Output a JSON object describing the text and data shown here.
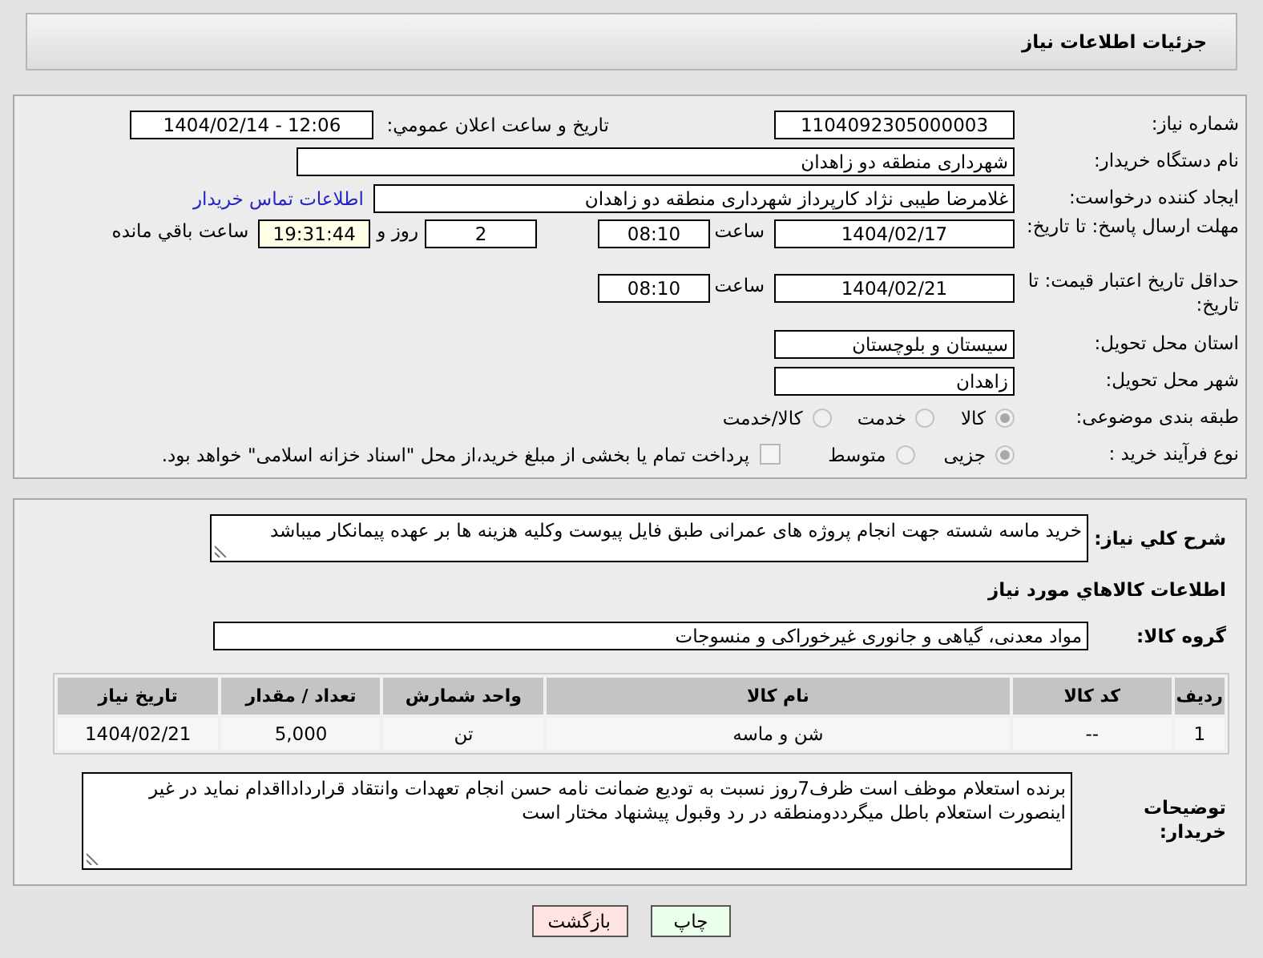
{
  "header": {
    "title": "جزئیات اطلاعات نیاز"
  },
  "need_number": {
    "label": "شماره نیاز:",
    "value": "1104092305000003"
  },
  "announce": {
    "label": "تاریخ و ساعت اعلان عمومي:",
    "value": "1404/02/14 - 12:06"
  },
  "buyer_org": {
    "label": "نام دستگاه خریدار:",
    "value": "شهرداری منطقه دو زاهدان"
  },
  "requester": {
    "label": "ایجاد کننده درخواست:",
    "value": "غلامرضا طیبی نژاد کارپرداز  شهرداری منطقه دو زاهدان",
    "link": "اطلاعات تماس خریدار"
  },
  "reply_deadline": {
    "label": "مهلت ارسال پاسخ: تا تاریخ:",
    "date": "1404/02/17",
    "time_label": "ساعت",
    "time": "08:10",
    "days": "2",
    "days_label": "روز و",
    "remaining": "19:31:44",
    "remaining_label": "ساعت باقي مانده"
  },
  "price_validity": {
    "label": "حداقل تاریخ اعتبار قیمت: تا تاریخ:",
    "date": "1404/02/21",
    "time_label": "ساعت",
    "time": "08:10"
  },
  "province": {
    "label": "استان محل تحویل:",
    "value": "سیستان و بلوچستان"
  },
  "city": {
    "label": "شهر محل تحویل:",
    "value": "زاهدان"
  },
  "category": {
    "label": "طبقه بندی موضوعی:",
    "options": [
      {
        "label": "کالا",
        "selected": true
      },
      {
        "label": "خدمت",
        "selected": false
      },
      {
        "label": "کالا/خدمت",
        "selected": false
      }
    ]
  },
  "purchase_type": {
    "label": "نوع فرآیند خرید :",
    "options": [
      {
        "label": "جزیی",
        "selected": true
      },
      {
        "label": "متوسط",
        "selected": false
      }
    ],
    "payment": {
      "label": "پرداخت تمام یا بخشی از مبلغ خرید،از محل \"اسناد خزانه اسلامی\" خواهد بود.",
      "checked": false
    }
  },
  "description": {
    "label": "شرح کلي نياز:",
    "value": "خرید ماسه شسته جهت انجام پروژه های عمرانی طبق فایل پیوست وکلیه هزینه ها بر عهده پیمانکار میباشد"
  },
  "goods_title": "اطلاعات کالاهاي مورد نياز",
  "goods_group": {
    "label": "گروه کالا:",
    "value": "مواد معدنی، گیاهی و جانوری غیرخوراکی و منسوجات"
  },
  "table": {
    "columns": [
      "ردیف",
      "کد کالا",
      "نام کالا",
      "واحد شمارش",
      "تعداد / مقدار",
      "تاریخ نیاز"
    ],
    "rows": [
      [
        "1",
        "--",
        "شن و ماسه",
        "تن",
        "5,000",
        "1404/02/21"
      ]
    ]
  },
  "buyer_notes": {
    "label": "توضیحات خریدار:",
    "value": "برنده استعلام موظف است ظرف7روز نسبت به تودیع ضمانت نامه حسن انجام تعهدات وانتقاد قراردادااقدام نماید در غیر اینصورت استعلام باطل میگرددومنطقه در رد وقبول پیشنهاد مختار است"
  },
  "buttons": [
    {
      "label": "چاپ",
      "kind": "print"
    },
    {
      "label": "بازگشت",
      "kind": "back"
    }
  ]
}
